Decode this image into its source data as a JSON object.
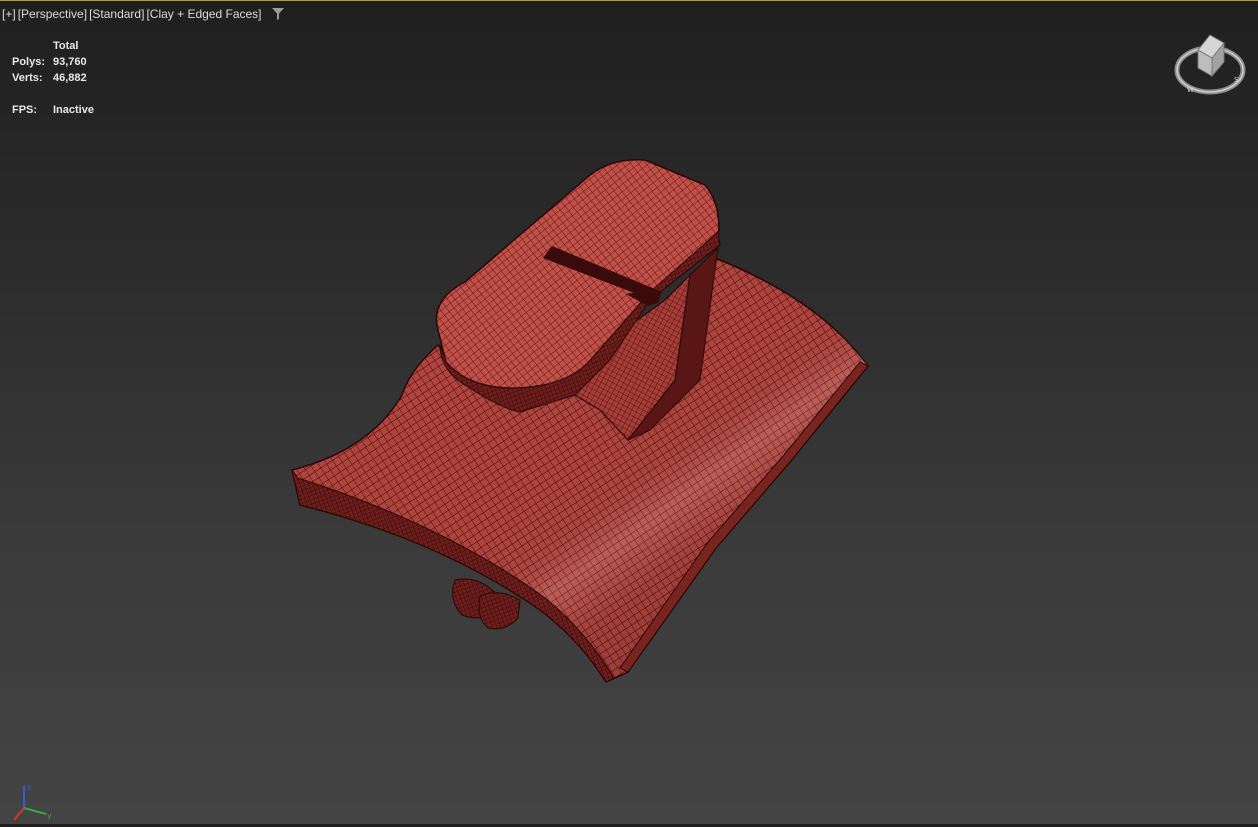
{
  "viewport": {
    "labels": [
      "[+]",
      "[Perspective]",
      "[Standard]",
      "[Clay + Edged Faces]"
    ],
    "filter_icon": "funnel-filter-icon",
    "border_color": "#b59a2d"
  },
  "stats": {
    "header": "Total",
    "polys_label": "Polys:",
    "polys_value": "93,760",
    "verts_label": "Verts:",
    "verts_value": "46,882",
    "fps_label": "FPS:",
    "fps_value": "Inactive"
  },
  "navigation": {
    "viewcube_icon": "viewcube-icon",
    "axis_icon": "axis-tripod-icon"
  },
  "model": {
    "shading": "Clay + Edged Faces",
    "fill_color": "#b3453f",
    "edge_color": "#3a0b0b"
  }
}
